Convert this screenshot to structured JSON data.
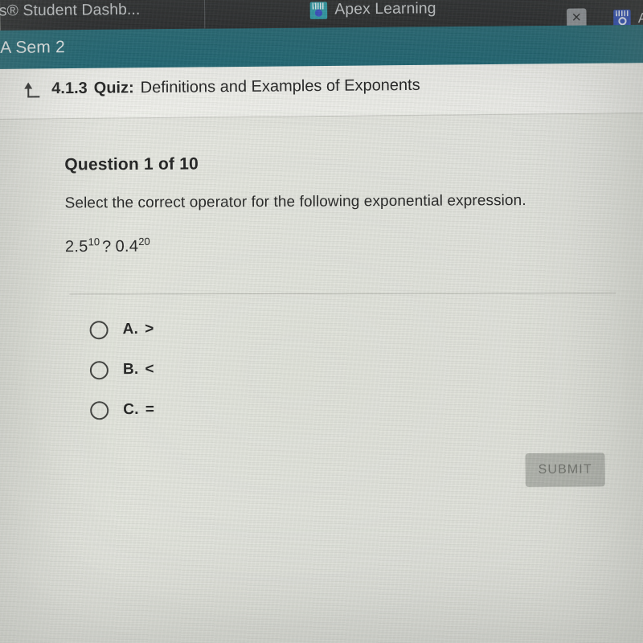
{
  "browser": {
    "tabs": [
      {
        "title": "us® Student Dashb...",
        "icon": "none-icon"
      },
      {
        "title": "Apex Learning",
        "icon": "apex-logo-icon"
      },
      {
        "title": "Ap",
        "icon": "blue-app-logo-icon"
      }
    ],
    "close_label": "✕",
    "chrome_color": "#1b1c1f"
  },
  "course_bar": {
    "title": "A Sem 2",
    "color": "#17616f"
  },
  "quiz_header": {
    "back_icon": "return-arrow-icon",
    "number": "4.1.3",
    "keyword": "Quiz:",
    "name": "Definitions and Examples of Exponents"
  },
  "question": {
    "counter": "Question 1 of 10",
    "prompt": "Select the correct operator for the following exponential expression.",
    "expression": {
      "left_base": "2.5",
      "left_exp": "10",
      "operator_placeholder": "?",
      "right_base": "0.4",
      "right_exp": "20"
    },
    "choices": [
      {
        "letter": "A.",
        "operator": ">",
        "selected": false
      },
      {
        "letter": "B.",
        "operator": "<",
        "selected": false
      },
      {
        "letter": "C.",
        "operator": "=",
        "selected": false
      }
    ]
  },
  "submit": {
    "label": "SUBMIT",
    "enabled": false,
    "color": "#b4b6b0"
  }
}
